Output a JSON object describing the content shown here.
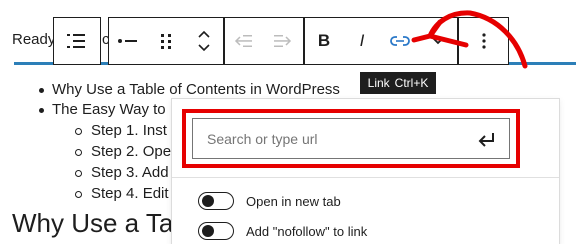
{
  "background": {
    "partial_text": "Ready",
    "partial_char": "c"
  },
  "toolbar": {
    "buttons": [
      {
        "name": "block-type",
        "icon": "table-of-contents-icon"
      },
      {
        "name": "list",
        "icon": "list-bullet-icon"
      },
      {
        "name": "drag",
        "icon": "drag-handle-icon"
      },
      {
        "name": "move",
        "icon": "move-up-down-icon"
      },
      {
        "name": "outdent",
        "icon": "outdent-icon"
      },
      {
        "name": "indent",
        "icon": "indent-icon"
      },
      {
        "name": "bold",
        "label": "B"
      },
      {
        "name": "italic",
        "label": "I"
      },
      {
        "name": "link",
        "icon": "link-icon"
      },
      {
        "name": "more-rich-text",
        "icon": "chevron-down-icon"
      },
      {
        "name": "options",
        "icon": "more-vertical-icon"
      }
    ]
  },
  "content": {
    "list": [
      {
        "level": 1,
        "text": "Why Use a Table of Contents in WordPress"
      },
      {
        "level": 1,
        "text": "The Easy Way to"
      },
      {
        "level": 2,
        "text": "Step 1. Inst"
      },
      {
        "level": 2,
        "text": "Step 2. Ope"
      },
      {
        "level": 2,
        "text": "Step 3. Add"
      },
      {
        "level": 2,
        "text": "Step 4. Edit"
      }
    ],
    "heading": "Why Use a Ta"
  },
  "tooltip": {
    "label": "Link",
    "shortcut": "Ctrl+K"
  },
  "link_popover": {
    "search_placeholder": "Search or type url",
    "search_value": "",
    "submit_icon": "enter-icon",
    "options": [
      {
        "label": "Open in new tab",
        "checked": false
      },
      {
        "label": "Add \"nofollow\" to link",
        "checked": false
      }
    ]
  },
  "annotation": {
    "highlight_color": "#e60000",
    "arrow_color": "#e60000"
  }
}
